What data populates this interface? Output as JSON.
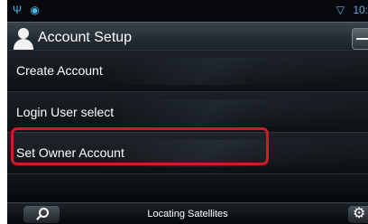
{
  "status_bar": {
    "left_icons": "Ψ ◉",
    "wifi_icon": "▽",
    "time": "10:"
  },
  "header": {
    "title": "Account Setup",
    "icon": "person-icon"
  },
  "menu": {
    "items": [
      {
        "label": "Create Account"
      },
      {
        "label": "Login User select"
      },
      {
        "label": "Set Owner Account"
      }
    ]
  },
  "bottom_bar": {
    "status_text": "Locating Satellites",
    "settings_icon": "⚙"
  },
  "colors": {
    "highlight_border": "#d11b2b",
    "status_icons": "#4fb3e8",
    "text": "#ffffff"
  }
}
